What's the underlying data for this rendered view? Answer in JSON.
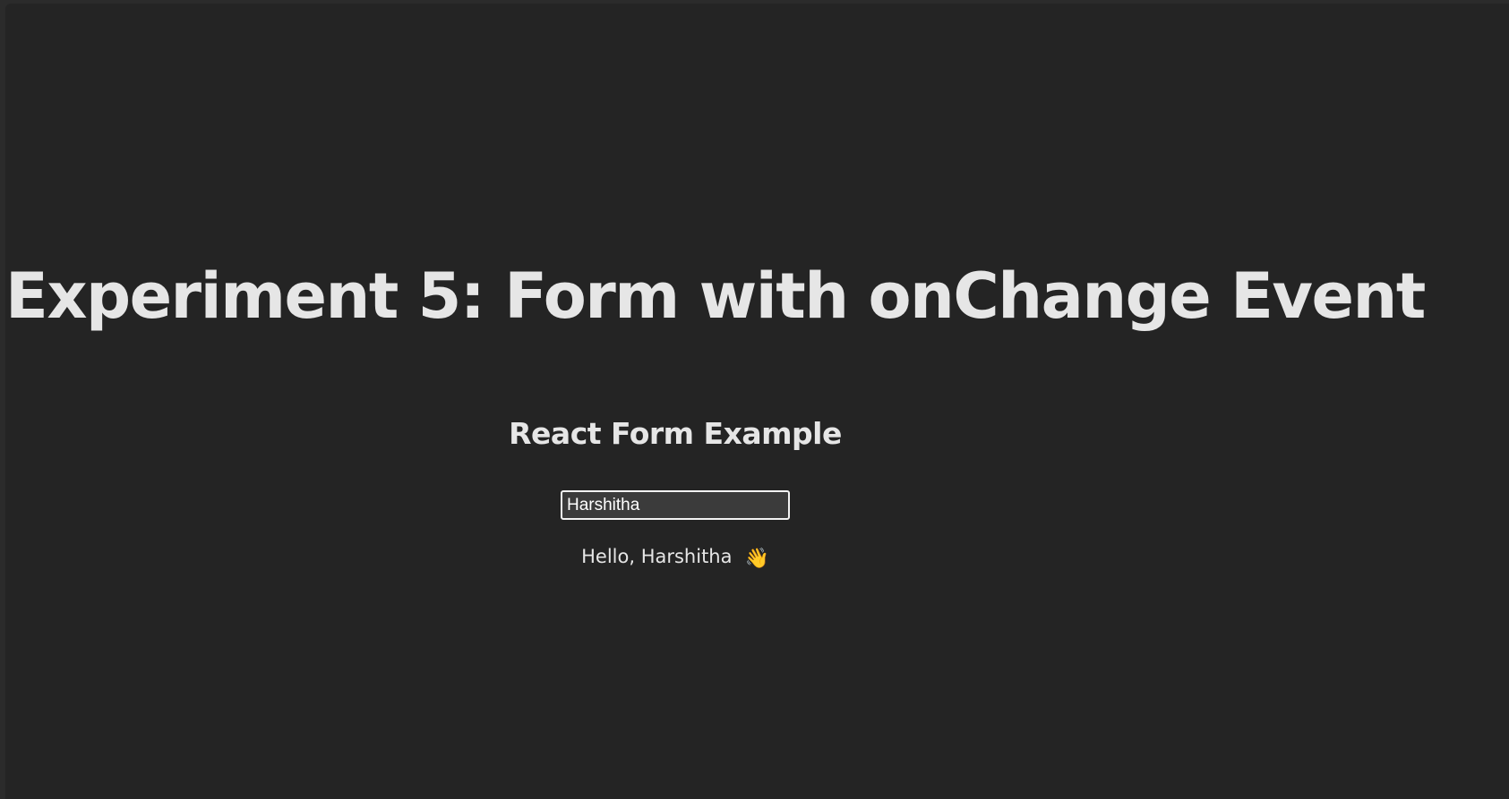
{
  "page": {
    "title": "Experiment 5: Form with onChange Event"
  },
  "form": {
    "heading": "React Form Example",
    "name_value": "Harshitha",
    "greeting": "Hello, Harshitha",
    "greeting_icon": "waving-hand-icon",
    "greeting_icon_glyph": "👋"
  },
  "colors": {
    "background": "#242424",
    "text": "#e6e6e6",
    "input_background": "#3b3b3b",
    "input_border": "#f2f2f2"
  }
}
